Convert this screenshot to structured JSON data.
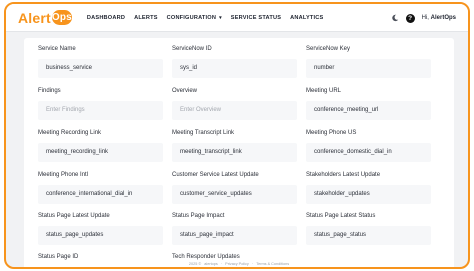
{
  "brand": {
    "name_left": "Alert",
    "name_badge": "Ops",
    "accent_color": "#f7941d"
  },
  "nav": {
    "dashboard": "DASHBOARD",
    "alerts": "ALERTS",
    "configuration": "CONFIGURATION",
    "service_status": "SERVICE STATUS",
    "analytics": "ANALYTICS"
  },
  "user": {
    "greeting_prefix": "Hi,",
    "name": "AlertOps"
  },
  "fields": [
    {
      "label": "Service Name",
      "value": "business_service",
      "placeholder": false
    },
    {
      "label": "ServiceNow ID",
      "value": "sys_id",
      "placeholder": false
    },
    {
      "label": "ServiceNow Key",
      "value": "number",
      "placeholder": false
    },
    {
      "label": "Findings",
      "value": "Enter Findings",
      "placeholder": true
    },
    {
      "label": "Overview",
      "value": "Enter Overview",
      "placeholder": true
    },
    {
      "label": "Meeting URL",
      "value": "conference_meeting_url",
      "placeholder": false
    },
    {
      "label": "Meeting Recording Link",
      "value": "meeting_recording_link",
      "placeholder": false
    },
    {
      "label": "Meeting Transcript Link",
      "value": "meeting_transcript_link",
      "placeholder": false
    },
    {
      "label": "Meeting Phone US",
      "value": "conference_domestic_dial_in",
      "placeholder": false
    },
    {
      "label": "Meeting Phone Intl",
      "value": "conference_international_dial_in",
      "placeholder": false
    },
    {
      "label": "Customer Service Latest Update",
      "value": "customer_service_updates",
      "placeholder": false
    },
    {
      "label": "Stakeholders Latest Update",
      "value": "stakeholder_updates",
      "placeholder": false
    },
    {
      "label": "Status Page Latest Update",
      "value": "status_page_updates",
      "placeholder": false
    },
    {
      "label": "Status Page Impact",
      "value": "status_page_impact",
      "placeholder": false
    },
    {
      "label": "Status Page Latest Status",
      "value": "status_page_status",
      "placeholder": false
    },
    {
      "label": "Status Page ID",
      "value": "",
      "placeholder": false
    },
    {
      "label": "Tech Responder Updates",
      "value": "",
      "placeholder": false
    }
  ],
  "footer": {
    "copyright": "2025 ©",
    "company": "alertops",
    "privacy": "Privacy Policy",
    "terms": "Terms & Conditions"
  }
}
